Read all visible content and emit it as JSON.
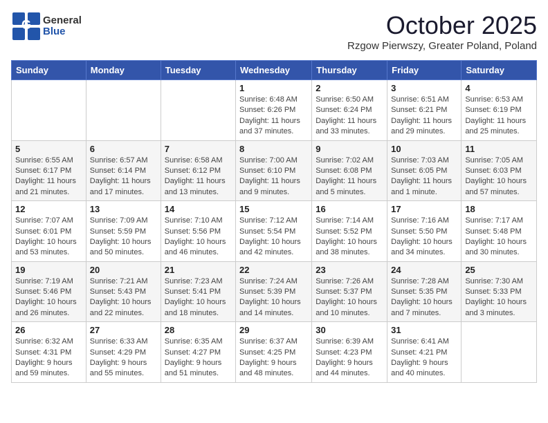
{
  "logo": {
    "general": "General",
    "blue": "Blue"
  },
  "header": {
    "month": "October 2025",
    "location": "Rzgow Pierwszy, Greater Poland, Poland"
  },
  "days_of_week": [
    "Sunday",
    "Monday",
    "Tuesday",
    "Wednesday",
    "Thursday",
    "Friday",
    "Saturday"
  ],
  "weeks": [
    {
      "shaded": false,
      "days": [
        {
          "num": "",
          "info": ""
        },
        {
          "num": "",
          "info": ""
        },
        {
          "num": "",
          "info": ""
        },
        {
          "num": "1",
          "info": "Sunrise: 6:48 AM\nSunset: 6:26 PM\nDaylight: 11 hours\nand 37 minutes."
        },
        {
          "num": "2",
          "info": "Sunrise: 6:50 AM\nSunset: 6:24 PM\nDaylight: 11 hours\nand 33 minutes."
        },
        {
          "num": "3",
          "info": "Sunrise: 6:51 AM\nSunset: 6:21 PM\nDaylight: 11 hours\nand 29 minutes."
        },
        {
          "num": "4",
          "info": "Sunrise: 6:53 AM\nSunset: 6:19 PM\nDaylight: 11 hours\nand 25 minutes."
        }
      ]
    },
    {
      "shaded": true,
      "days": [
        {
          "num": "5",
          "info": "Sunrise: 6:55 AM\nSunset: 6:17 PM\nDaylight: 11 hours\nand 21 minutes."
        },
        {
          "num": "6",
          "info": "Sunrise: 6:57 AM\nSunset: 6:14 PM\nDaylight: 11 hours\nand 17 minutes."
        },
        {
          "num": "7",
          "info": "Sunrise: 6:58 AM\nSunset: 6:12 PM\nDaylight: 11 hours\nand 13 minutes."
        },
        {
          "num": "8",
          "info": "Sunrise: 7:00 AM\nSunset: 6:10 PM\nDaylight: 11 hours\nand 9 minutes."
        },
        {
          "num": "9",
          "info": "Sunrise: 7:02 AM\nSunset: 6:08 PM\nDaylight: 11 hours\nand 5 minutes."
        },
        {
          "num": "10",
          "info": "Sunrise: 7:03 AM\nSunset: 6:05 PM\nDaylight: 11 hours\nand 1 minute."
        },
        {
          "num": "11",
          "info": "Sunrise: 7:05 AM\nSunset: 6:03 PM\nDaylight: 10 hours\nand 57 minutes."
        }
      ]
    },
    {
      "shaded": false,
      "days": [
        {
          "num": "12",
          "info": "Sunrise: 7:07 AM\nSunset: 6:01 PM\nDaylight: 10 hours\nand 53 minutes."
        },
        {
          "num": "13",
          "info": "Sunrise: 7:09 AM\nSunset: 5:59 PM\nDaylight: 10 hours\nand 50 minutes."
        },
        {
          "num": "14",
          "info": "Sunrise: 7:10 AM\nSunset: 5:56 PM\nDaylight: 10 hours\nand 46 minutes."
        },
        {
          "num": "15",
          "info": "Sunrise: 7:12 AM\nSunset: 5:54 PM\nDaylight: 10 hours\nand 42 minutes."
        },
        {
          "num": "16",
          "info": "Sunrise: 7:14 AM\nSunset: 5:52 PM\nDaylight: 10 hours\nand 38 minutes."
        },
        {
          "num": "17",
          "info": "Sunrise: 7:16 AM\nSunset: 5:50 PM\nDaylight: 10 hours\nand 34 minutes."
        },
        {
          "num": "18",
          "info": "Sunrise: 7:17 AM\nSunset: 5:48 PM\nDaylight: 10 hours\nand 30 minutes."
        }
      ]
    },
    {
      "shaded": true,
      "days": [
        {
          "num": "19",
          "info": "Sunrise: 7:19 AM\nSunset: 5:46 PM\nDaylight: 10 hours\nand 26 minutes."
        },
        {
          "num": "20",
          "info": "Sunrise: 7:21 AM\nSunset: 5:43 PM\nDaylight: 10 hours\nand 22 minutes."
        },
        {
          "num": "21",
          "info": "Sunrise: 7:23 AM\nSunset: 5:41 PM\nDaylight: 10 hours\nand 18 minutes."
        },
        {
          "num": "22",
          "info": "Sunrise: 7:24 AM\nSunset: 5:39 PM\nDaylight: 10 hours\nand 14 minutes."
        },
        {
          "num": "23",
          "info": "Sunrise: 7:26 AM\nSunset: 5:37 PM\nDaylight: 10 hours\nand 10 minutes."
        },
        {
          "num": "24",
          "info": "Sunrise: 7:28 AM\nSunset: 5:35 PM\nDaylight: 10 hours\nand 7 minutes."
        },
        {
          "num": "25",
          "info": "Sunrise: 7:30 AM\nSunset: 5:33 PM\nDaylight: 10 hours\nand 3 minutes."
        }
      ]
    },
    {
      "shaded": false,
      "days": [
        {
          "num": "26",
          "info": "Sunrise: 6:32 AM\nSunset: 4:31 PM\nDaylight: 9 hours\nand 59 minutes."
        },
        {
          "num": "27",
          "info": "Sunrise: 6:33 AM\nSunset: 4:29 PM\nDaylight: 9 hours\nand 55 minutes."
        },
        {
          "num": "28",
          "info": "Sunrise: 6:35 AM\nSunset: 4:27 PM\nDaylight: 9 hours\nand 51 minutes."
        },
        {
          "num": "29",
          "info": "Sunrise: 6:37 AM\nSunset: 4:25 PM\nDaylight: 9 hours\nand 48 minutes."
        },
        {
          "num": "30",
          "info": "Sunrise: 6:39 AM\nSunset: 4:23 PM\nDaylight: 9 hours\nand 44 minutes."
        },
        {
          "num": "31",
          "info": "Sunrise: 6:41 AM\nSunset: 4:21 PM\nDaylight: 9 hours\nand 40 minutes."
        },
        {
          "num": "",
          "info": ""
        }
      ]
    }
  ]
}
